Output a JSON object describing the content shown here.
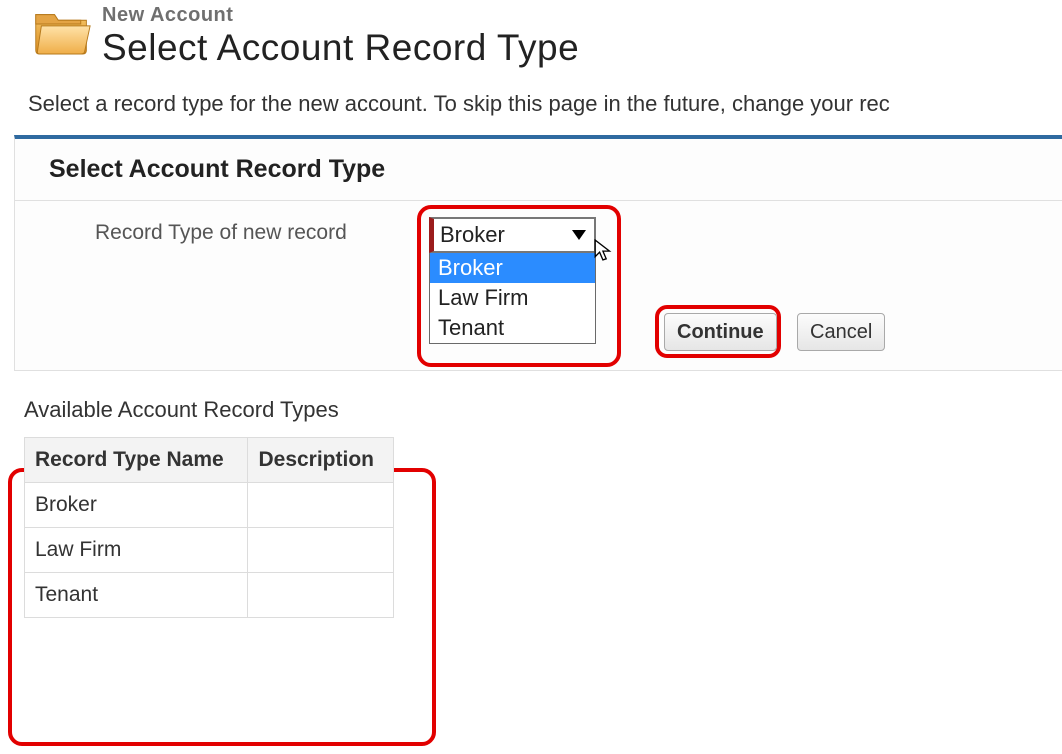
{
  "header": {
    "eyebrow": "New Account",
    "title": "Select Account Record Type"
  },
  "intro": "Select a record type for the new account. To skip this page in the future, change your rec",
  "panel": {
    "title": "Select Account Record Type",
    "field_label": "Record Type of new record",
    "select": {
      "value": "Broker",
      "options": [
        "Broker",
        "Law Firm",
        "Tenant"
      ],
      "highlighted_index": 0
    },
    "buttons": {
      "continue": "Continue",
      "cancel": "Cancel"
    }
  },
  "available": {
    "title": "Available Account Record Types",
    "columns": [
      "Record Type Name",
      "Description"
    ],
    "rows": [
      {
        "name": "Broker",
        "description": ""
      },
      {
        "name": "Law Firm",
        "description": ""
      },
      {
        "name": "Tenant",
        "description": ""
      }
    ]
  }
}
